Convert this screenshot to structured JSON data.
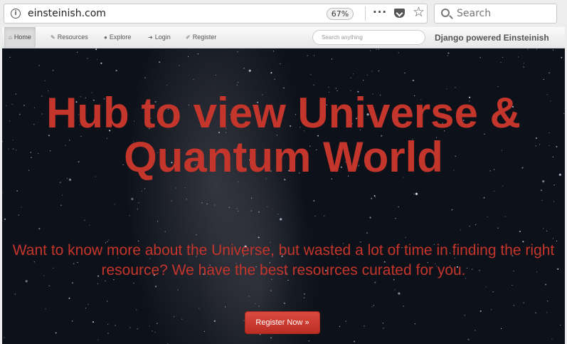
{
  "browser": {
    "url": "einsteinish.com",
    "zoom": "67%",
    "search_placeholder": "Search",
    "more_icon": "···",
    "star_icon": "☆",
    "info_icon": "i"
  },
  "nav": {
    "items": [
      {
        "icon": "home-icon",
        "glyph": "⌂",
        "label": "Home",
        "active": true
      },
      {
        "icon": "pushpin-icon",
        "glyph": "✎",
        "label": "Resources"
      },
      {
        "icon": "globe-icon",
        "glyph": "●",
        "label": "Explore"
      },
      {
        "icon": "login-icon",
        "glyph": "➜",
        "label": "Login"
      },
      {
        "icon": "key-icon",
        "glyph": "✐",
        "label": "Register"
      }
    ],
    "search_placeholder": "Search anything",
    "brand": "Django powered Einsteinish"
  },
  "hero": {
    "title": "Hub to view Universe & Quantum World",
    "subtitle": "Want to know more about the Universe, but wasted a lot of time in finding the right resource? We have the best resources curated for you.",
    "cta": "Register Now »",
    "accent_color": "#c4352b"
  }
}
